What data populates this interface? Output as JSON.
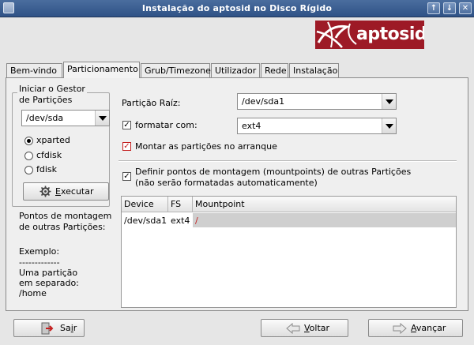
{
  "window": {
    "title": "Instalação do aptosid no Disco Rígido",
    "controls": [
      "↑",
      "↓",
      "✕"
    ]
  },
  "logo": {
    "text": "aptosid",
    "color": "#9d1a26"
  },
  "tabs": [
    {
      "label": "Bem-vindo"
    },
    {
      "label": "Particionamento"
    },
    {
      "label": "Grub/Timezone"
    },
    {
      "label": "Utilizador"
    },
    {
      "label": "Rede"
    },
    {
      "label": "Instalação"
    }
  ],
  "partition_manager": {
    "title_line1": "Iniciar o Gestor",
    "title_line2": "de Partições",
    "disk": "/dev/sda",
    "options": [
      {
        "label": "xparted",
        "selected": true
      },
      {
        "label": "cfdisk",
        "selected": false
      },
      {
        "label": "fdisk",
        "selected": false
      }
    ],
    "execute_prefix": "",
    "execute_mnemonic": "E",
    "execute_rest": "xecutar"
  },
  "help": {
    "lines": [
      "Pontos de montagem",
      "de outras Partições:",
      "",
      "Exemplo:",
      "-------------",
      "Uma partição",
      "em separado:",
      "/home"
    ]
  },
  "form": {
    "root_label": "Partição Raíz:",
    "root_value": "/dev/sda1",
    "format_label": "formatar com:",
    "format_value": "ext4",
    "format_checked": true,
    "mount_label": "Montar as partições no arranque",
    "mount_checked": true,
    "define_line1": "Definir pontos de montagem (mountpoints) de outras Partições",
    "define_line2": "(não serão formatadas automaticamente)",
    "define_checked": true
  },
  "mount_table": {
    "headers": [
      "Device",
      "FS",
      "Mountpoint"
    ],
    "rows": [
      {
        "device": "/dev/sda1",
        "fs": "ext4",
        "mountpoint": "/"
      }
    ]
  },
  "buttons": {
    "quit_prefix": "Sa",
    "quit_mnemonic": "i",
    "quit_rest": "r",
    "back_prefix": "",
    "back_mnemonic": "V",
    "back_rest": "oltar",
    "next_prefix": "",
    "next_mnemonic": "A",
    "next_rest": "vançar"
  },
  "colors": {
    "titlebar": "#2f5286",
    "brand_red": "#9d1a26",
    "check_red": "#c42020"
  }
}
